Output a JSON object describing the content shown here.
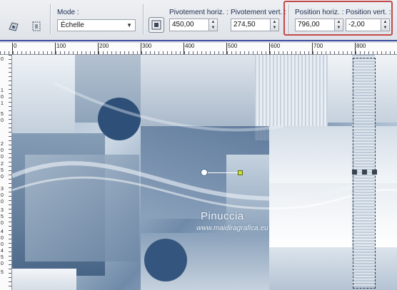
{
  "toolbar": {
    "mode": {
      "label": "Mode :",
      "value": "Échelle"
    },
    "pivot_h": {
      "label": "Pivotement horiz. :",
      "value": "450,00"
    },
    "pivot_v": {
      "label": "Pivotement vert. :",
      "value": "274,50"
    },
    "pos_h": {
      "label": "Position horiz. :",
      "value": "796,00"
    },
    "pos_v": {
      "label": "Position vert. :",
      "value": "-2,00"
    }
  },
  "ruler": {
    "horizontal": [
      "0",
      "100",
      "200",
      "300",
      "400",
      "500",
      "600",
      "700",
      "800"
    ],
    "vertical": [
      "0",
      "1",
      "0",
      "1",
      "5",
      "0",
      "2",
      "0",
      "0",
      "2",
      "5",
      "0",
      "3",
      "0",
      "0",
      "3",
      "5",
      "0",
      "4",
      "0",
      "0",
      "4",
      "5",
      "0",
      "5"
    ]
  },
  "watermark": {
    "name": "Pinuccia",
    "url": "www.maidiragrafica.eu"
  },
  "colors": {
    "accent": "#3e4fa2",
    "highlight": "#c4484a",
    "pivot": "#c8e03a"
  }
}
